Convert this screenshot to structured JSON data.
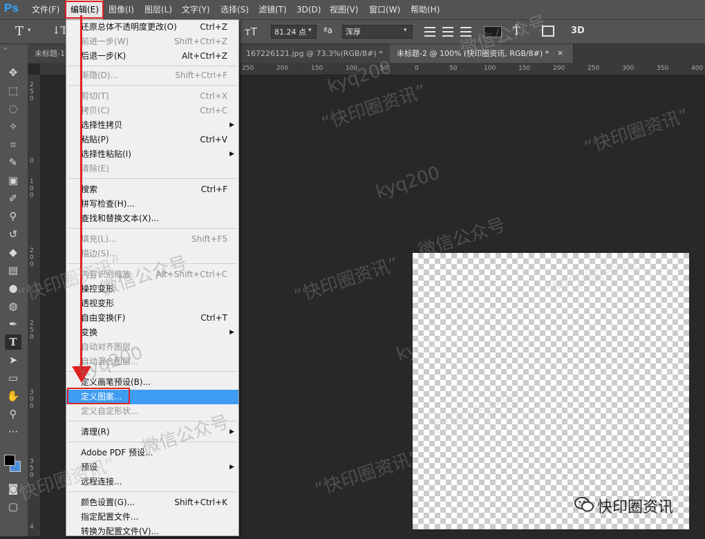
{
  "app": {
    "logo": "Ps"
  },
  "menubar": {
    "items": [
      "文件(F)",
      "编辑(E)",
      "图像(I)",
      "图层(L)",
      "文字(Y)",
      "选择(S)",
      "滤镜(T)",
      "3D(D)",
      "视图(V)",
      "窗口(W)",
      "帮助(H)"
    ]
  },
  "options": {
    "tool_glyph": "T",
    "font_size": "81.24 点",
    "aa_label": "ªa",
    "aa_value": "浑厚",
    "tool_3d": "3D"
  },
  "tabs": [
    {
      "label": "未标题-1"
    },
    {
      "label": "167226121.jpg @ 73.3%(RGB/8#) *"
    },
    {
      "label": "未标题-2 @ 100% (快印圈资讯, RGB/8#) *"
    }
  ],
  "ruler": {
    "top": [
      "250",
      "200",
      "150",
      "100",
      "50",
      "0",
      "50",
      "100",
      "150",
      "200",
      "250",
      "300",
      "350",
      "400"
    ],
    "left": [
      "2",
      "5",
      "0",
      "5",
      "0",
      "5",
      "0",
      "1",
      "0",
      "0",
      "1",
      "5",
      "0",
      "2",
      "0",
      "0",
      "2",
      "5",
      "0",
      "3",
      "0",
      "0",
      "3",
      "5",
      "0",
      "4",
      "0"
    ]
  },
  "menu": {
    "items": [
      {
        "label": "还原总体不透明度更改(O)",
        "shortcut": "Ctrl+Z",
        "disabled": false
      },
      {
        "label": "前进一步(W)",
        "shortcut": "Shift+Ctrl+Z",
        "disabled": true
      },
      {
        "label": "后退一步(K)",
        "shortcut": "Alt+Ctrl+Z",
        "disabled": false
      },
      {
        "label": "渐隐(D)...",
        "shortcut": "Shift+Ctrl+F",
        "disabled": true
      },
      {
        "label": "剪切(T)",
        "shortcut": "Ctrl+X",
        "disabled": true
      },
      {
        "label": "拷贝(C)",
        "shortcut": "Ctrl+C",
        "disabled": true
      },
      {
        "label": "选择性拷贝",
        "shortcut": "",
        "disabled": false
      },
      {
        "label": "粘贴(P)",
        "shortcut": "Ctrl+V",
        "disabled": false
      },
      {
        "label": "选择性粘贴(I)",
        "shortcut": "",
        "disabled": false
      },
      {
        "label": "清除(E)",
        "shortcut": "",
        "disabled": true
      },
      {
        "label": "搜索",
        "shortcut": "Ctrl+F",
        "disabled": false
      },
      {
        "label": "拼写检查(H)...",
        "shortcut": "",
        "disabled": false
      },
      {
        "label": "查找和替换文本(X)...",
        "shortcut": "",
        "disabled": false
      },
      {
        "label": "填充(L)...",
        "shortcut": "Shift+F5",
        "disabled": true
      },
      {
        "label": "描边(S)...",
        "shortcut": "",
        "disabled": true
      },
      {
        "label": "内容识别缩放",
        "shortcut": "Alt+Shift+Ctrl+C",
        "disabled": true
      },
      {
        "label": "操控变形",
        "shortcut": "",
        "disabled": false
      },
      {
        "label": "透视变形",
        "shortcut": "",
        "disabled": false
      },
      {
        "label": "自由变换(F)",
        "shortcut": "Ctrl+T",
        "disabled": false
      },
      {
        "label": "变换",
        "shortcut": "",
        "disabled": false
      },
      {
        "label": "自动对齐图层...",
        "shortcut": "",
        "disabled": true
      },
      {
        "label": "自动混合图层...",
        "shortcut": "",
        "disabled": true
      },
      {
        "label": "定义画笔预设(B)...",
        "shortcut": "",
        "disabled": false
      },
      {
        "label": "定义图案...",
        "shortcut": "",
        "disabled": false
      },
      {
        "label": "定义自定形状...",
        "shortcut": "",
        "disabled": true
      },
      {
        "label": "清理(R)",
        "shortcut": "",
        "disabled": false
      },
      {
        "label": "Adobe PDF 预设...",
        "shortcut": "",
        "disabled": false
      },
      {
        "label": "预设",
        "shortcut": "",
        "disabled": false
      },
      {
        "label": "远程连接...",
        "shortcut": "",
        "disabled": false
      },
      {
        "label": "颜色设置(G)...",
        "shortcut": "Shift+Ctrl+K",
        "disabled": false
      },
      {
        "label": "指定配置文件...",
        "shortcut": "",
        "disabled": false
      },
      {
        "label": "转换为配置文件(V)...",
        "shortcut": "",
        "disabled": false
      }
    ]
  },
  "watermarks": {
    "kyq": "kyq200",
    "brand_quote": "“快印圈资讯”",
    "wechat": "微信公众号",
    "brand": "快印圈资讯"
  },
  "colors": {
    "menu_highlight": "#3e9cf2",
    "annotation_red": "#e02020"
  }
}
